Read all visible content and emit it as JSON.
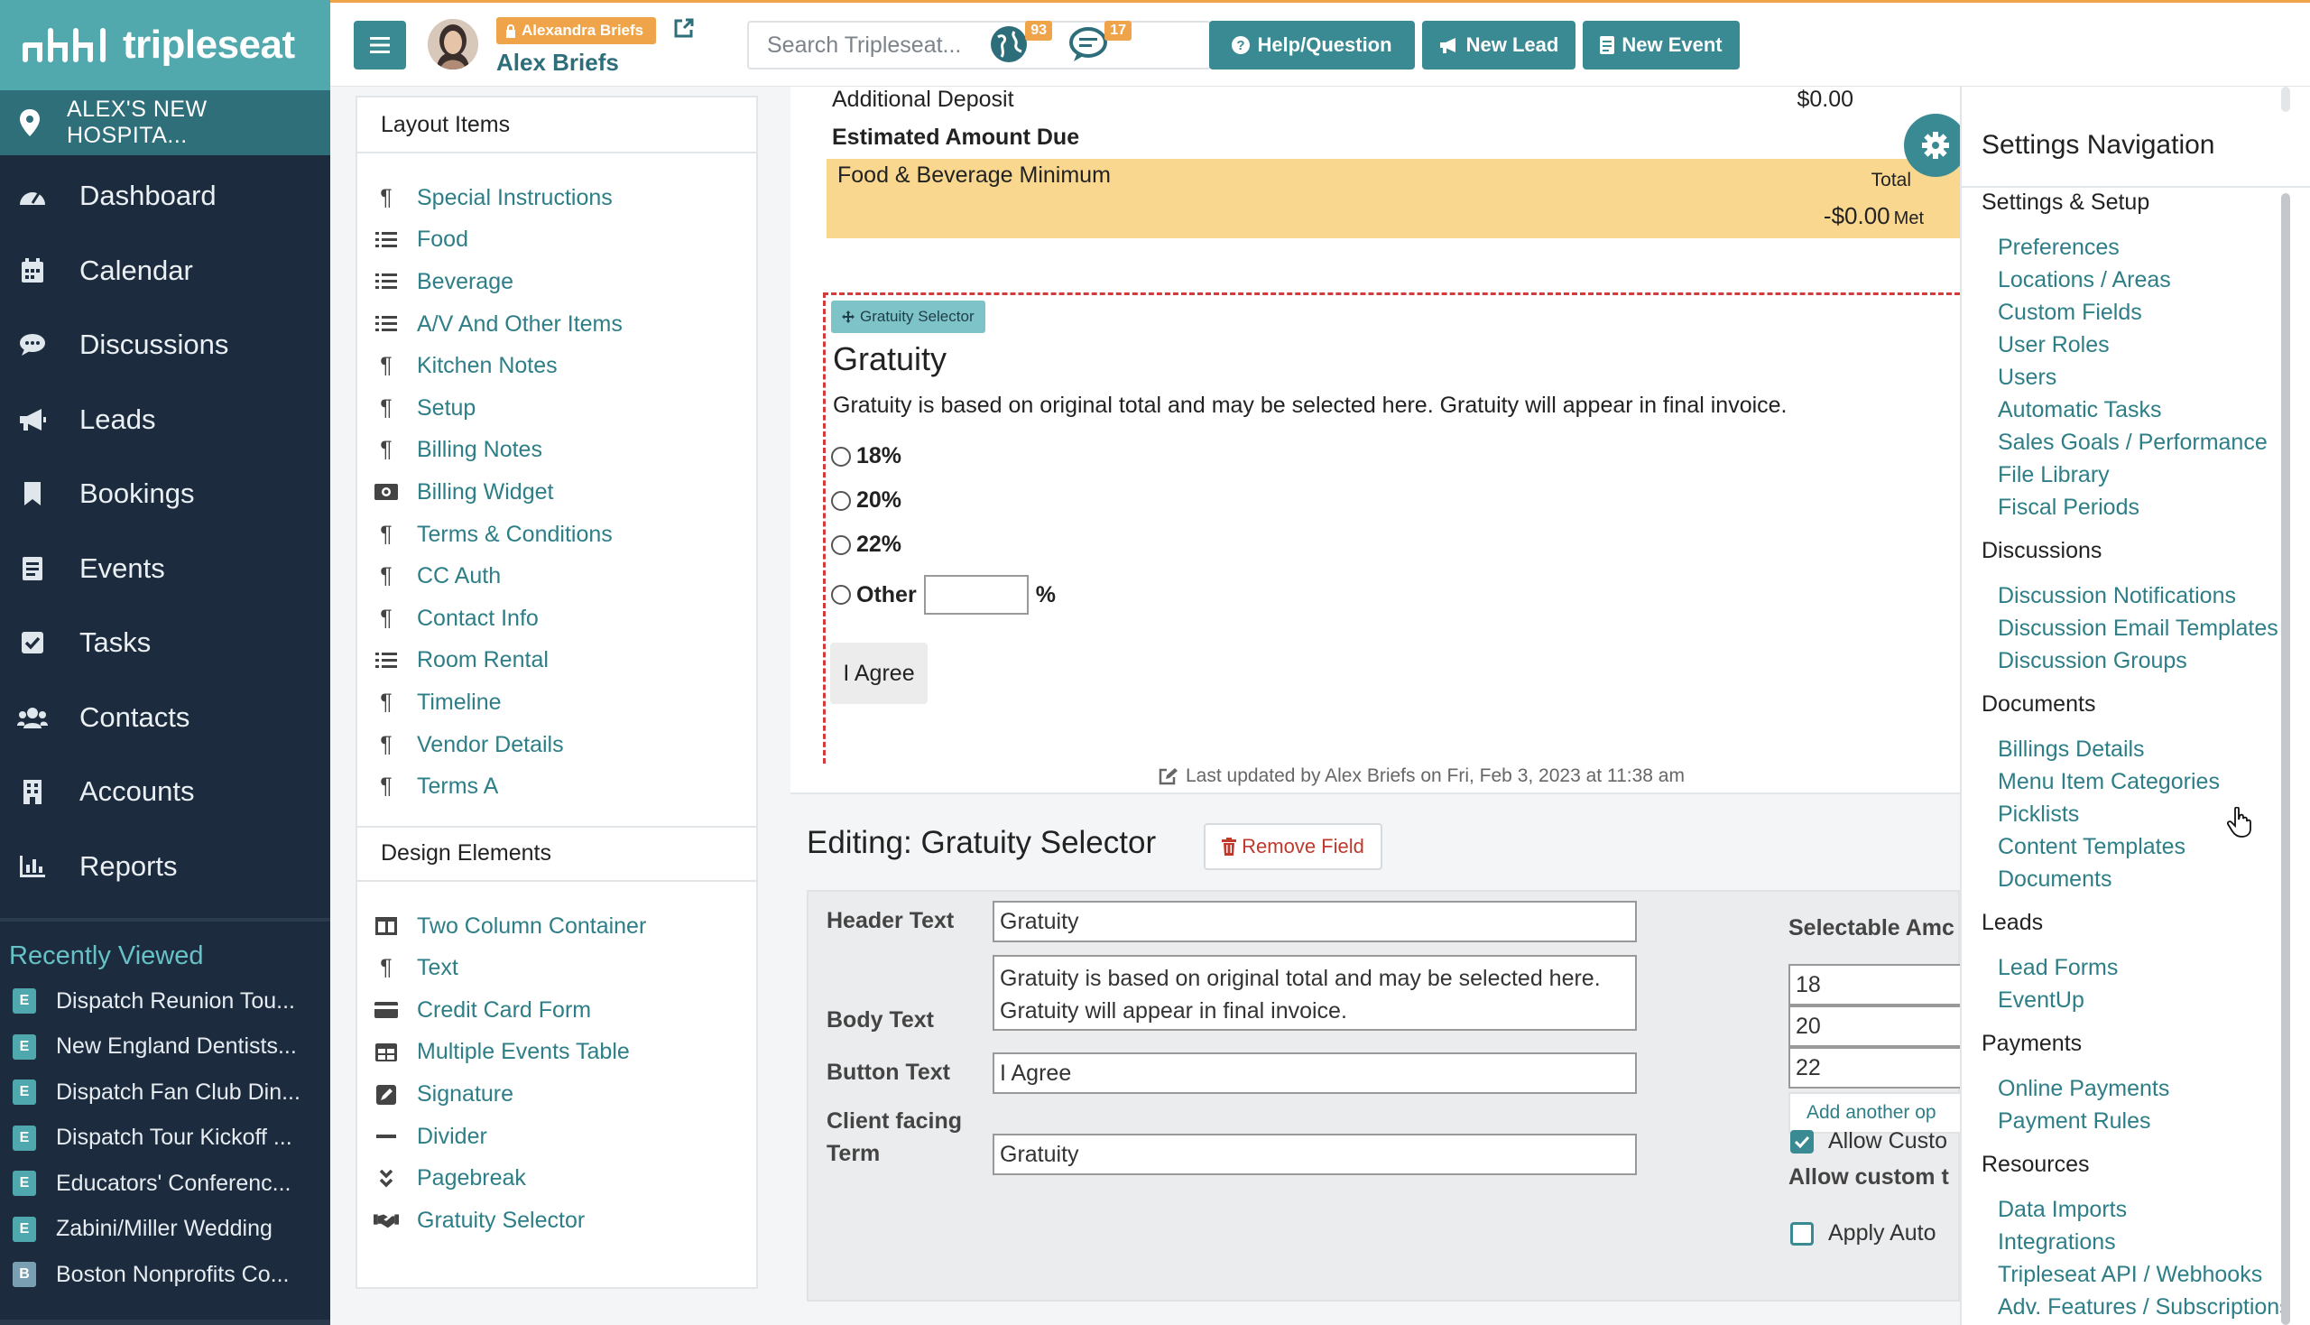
{
  "app": {
    "logo_text": "tripleseat",
    "venue": "ALEX'S NEW HOSPITA..."
  },
  "sidebar": {
    "items": [
      {
        "label": "Dashboard",
        "icon": "dashboard-icon"
      },
      {
        "label": "Calendar",
        "icon": "calendar-icon"
      },
      {
        "label": "Discussions",
        "icon": "discussions-icon"
      },
      {
        "label": "Leads",
        "icon": "megaphone-icon"
      },
      {
        "label": "Bookings",
        "icon": "bookmark-icon"
      },
      {
        "label": "Events",
        "icon": "events-icon"
      },
      {
        "label": "Tasks",
        "icon": "tasks-icon"
      },
      {
        "label": "Contacts",
        "icon": "contacts-icon"
      },
      {
        "label": "Accounts",
        "icon": "building-icon"
      },
      {
        "label": "Reports",
        "icon": "reports-icon"
      }
    ],
    "recent_title": "Recently Viewed",
    "recent": [
      {
        "badge": "E",
        "label": "Dispatch Reunion Tou..."
      },
      {
        "badge": "E",
        "label": "New England Dentists..."
      },
      {
        "badge": "E",
        "label": "Dispatch Fan Club Din..."
      },
      {
        "badge": "E",
        "label": "Dispatch Tour Kickoff ..."
      },
      {
        "badge": "E",
        "label": "Educators' Conferenc..."
      },
      {
        "badge": "E",
        "label": "Zabini/Miller Wedding"
      },
      {
        "badge": "B",
        "label": "Boston Nonprofits Co..."
      }
    ]
  },
  "header": {
    "user_badge": "Alexandra Briefs",
    "user_name": "Alex Briefs",
    "search_placeholder": "Search Tripleseat...",
    "notifications_count": "93",
    "messages_count": "17",
    "help_label": "Help/Question",
    "new_lead_label": "New Lead",
    "new_event_label": "New Event"
  },
  "layout_panel": {
    "title": "Layout Items",
    "items": [
      {
        "label": "Special Instructions",
        "icon": "paragraph-icon"
      },
      {
        "label": "Food",
        "icon": "list-icon"
      },
      {
        "label": "Beverage",
        "icon": "list-icon"
      },
      {
        "label": "A/V And Other Items",
        "icon": "list-icon"
      },
      {
        "label": "Kitchen Notes",
        "icon": "paragraph-icon"
      },
      {
        "label": "Setup",
        "icon": "paragraph-icon"
      },
      {
        "label": "Billing Notes",
        "icon": "paragraph-icon"
      },
      {
        "label": "Billing Widget",
        "icon": "money-icon"
      },
      {
        "label": "Terms & Conditions",
        "icon": "paragraph-icon"
      },
      {
        "label": "CC Auth",
        "icon": "paragraph-icon"
      },
      {
        "label": "Contact Info",
        "icon": "paragraph-icon"
      },
      {
        "label": "Room Rental",
        "icon": "list-icon"
      },
      {
        "label": "Timeline",
        "icon": "paragraph-icon"
      },
      {
        "label": "Vendor Details",
        "icon": "paragraph-icon"
      },
      {
        "label": "Terms A",
        "icon": "paragraph-icon"
      }
    ],
    "design_title": "Design Elements",
    "design_items": [
      {
        "label": "Two Column Container",
        "icon": "columns-icon"
      },
      {
        "label": "Text",
        "icon": "paragraph-icon"
      },
      {
        "label": "Credit Card Form",
        "icon": "credit-card-icon"
      },
      {
        "label": "Multiple Events Table",
        "icon": "table-icon"
      },
      {
        "label": "Signature",
        "icon": "signature-icon"
      },
      {
        "label": "Divider",
        "icon": "divider-icon"
      },
      {
        "label": "Pagebreak",
        "icon": "pagebreak-icon"
      },
      {
        "label": "Gratuity Selector",
        "icon": "handshake-icon"
      }
    ]
  },
  "document": {
    "additional_deposit_label": "Additional Deposit",
    "additional_deposit_value": "$0.00",
    "estimated_due_label": "Estimated Amount Due",
    "fbm_title": "Food & Beverage Minimum",
    "fbm_total_label": "Total",
    "fbm_amount": "-$0.00",
    "fbm_met": "Met",
    "gratuity_tag": "Gratuity Selector",
    "gratuity_title": "Gratuity",
    "gratuity_body": "Gratuity is based on original total and may be selected here. Gratuity will appear in final invoice.",
    "options": [
      "18%",
      "20%",
      "22%"
    ],
    "other_label": "Other",
    "percent_sign": "%",
    "agree_label": "I Agree",
    "last_updated": "Last updated by Alex Briefs on Fri, Feb 3, 2023 at 11:38 am"
  },
  "editor": {
    "title": "Editing: Gratuity Selector",
    "remove_label": "Remove Field",
    "header_text_label": "Header Text",
    "header_text_value": "Gratuity",
    "body_text_label": "Body Text",
    "body_text_value": "Gratuity is based on original total and may be selected here. Gratuity will appear in final invoice.",
    "button_text_label": "Button Text",
    "button_text_value": "I Agree",
    "client_term_label_1": "Client facing",
    "client_term_label_2": "Term",
    "client_term_value": "Gratuity",
    "selectable_label": "Selectable Amc",
    "selectable_values": [
      "18",
      "20",
      "22"
    ],
    "add_option_label": "Add another op",
    "allow_custom_label": "Allow Custo",
    "allow_custom_sub": "Allow custom t",
    "apply_auto_label": "Apply Auto"
  },
  "settings_nav": {
    "title": "Settings Navigation",
    "sections": [
      {
        "title": "Settings & Setup",
        "links": [
          "Preferences",
          "Locations / Areas",
          "Custom Fields",
          "User Roles",
          "Users",
          "Automatic Tasks",
          "Sales Goals / Performance",
          "File Library",
          "Fiscal Periods"
        ]
      },
      {
        "title": "Discussions",
        "links": [
          "Discussion Notifications",
          "Discussion Email Templates",
          "Discussion Groups"
        ]
      },
      {
        "title": "Documents",
        "links": [
          "Billings Details",
          "Menu Item Categories",
          "Picklists",
          "Content Templates",
          "Documents"
        ]
      },
      {
        "title": "Leads",
        "links": [
          "Lead Forms",
          "EventUp"
        ]
      },
      {
        "title": "Payments",
        "links": [
          "Online Payments",
          "Payment Rules"
        ]
      },
      {
        "title": "Resources",
        "links": [
          "Data Imports",
          "Integrations",
          "Tripleseat API / Webhooks",
          "Adv. Features / Subscriptions"
        ]
      }
    ]
  },
  "colors": {
    "teal": "#3a8a93",
    "sidebar_bg": "#1c2b3d",
    "accent_orange": "#f0a44a",
    "fbm_yellow": "#f9d78f",
    "link": "#2d7e86"
  }
}
